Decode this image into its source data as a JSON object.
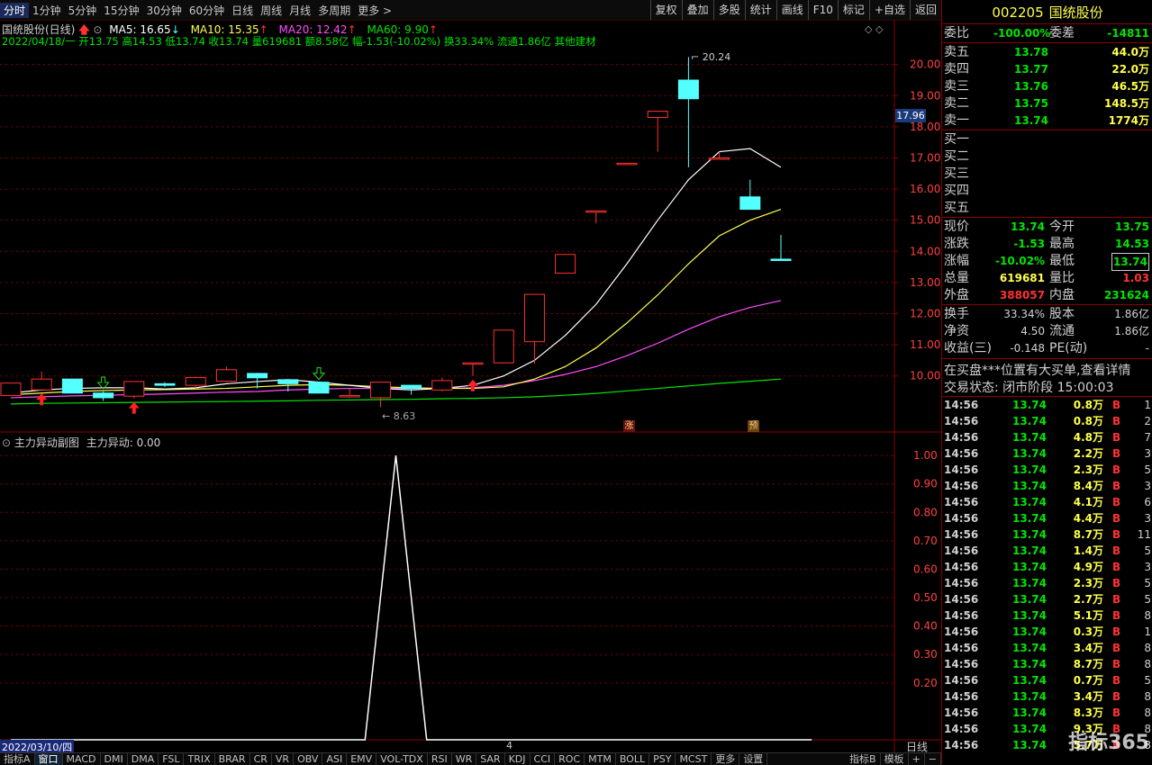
{
  "toolbar": {
    "periods": [
      "分时",
      "1分钟",
      "5分钟",
      "15分钟",
      "30分钟",
      "60分钟",
      "日线",
      "周线",
      "月线",
      "多周期",
      "更多 >"
    ],
    "buttons": [
      "复权",
      "叠加",
      "多股",
      "统计",
      "画线",
      "F10",
      "标记",
      "+自选",
      "返回"
    ]
  },
  "chart_header": {
    "name": "国统股份(日线)",
    "ma5": "MA5: 16.65",
    "ma10": "MA10: 15.35",
    "ma20": "MA20: 12.42",
    "ma60": "MA60: 9.90",
    "ohlc": "2022/04/18/一 开13.75 高14.53 低13.74 收13.74 量619681 额8.58亿 幅-1.53(-10.02%) 换33.34% 流通1.86亿 其他建材",
    "high_label": "20.24",
    "low_label": "8.63",
    "current_price_tag": "17.96",
    "badge_zhang": "涨",
    "badge_yu": "预"
  },
  "sub_header": {
    "title": "主力异动副图",
    "value": "主力异动: 0.00"
  },
  "x_axis": {
    "start": "2022/03/10/四",
    "mark": "4",
    "period": "日线"
  },
  "colors": {
    "up": "#ff3232",
    "down": "#54ffff",
    "ma5": "#ffffff",
    "ma10": "#ffff4c",
    "ma20": "#ff4cff",
    "ma60": "#00e600",
    "grid": "#8a0000"
  },
  "chart_data": [
    {
      "type": "candlestick",
      "y_ticks": [
        10,
        11,
        12,
        13,
        14,
        15,
        16,
        17,
        18,
        19,
        20
      ],
      "ylim": [
        8.2,
        20.8
      ],
      "candles": [
        {
          "o": 9.37,
          "c": 9.77,
          "h": 9.77,
          "l": 9.37
        },
        {
          "o": 9.55,
          "c": 9.9,
          "h": 10.14,
          "l": 9.55
        },
        {
          "o": 9.9,
          "c": 9.45,
          "h": 9.9,
          "l": 9.45
        },
        {
          "o": 9.45,
          "c": 9.3,
          "h": 9.5,
          "l": 9.2
        },
        {
          "o": 9.35,
          "c": 9.82,
          "h": 9.82,
          "l": 9.28
        },
        {
          "o": 9.75,
          "c": 9.7,
          "h": 9.8,
          "l": 9.65
        },
        {
          "o": 9.7,
          "c": 9.95,
          "h": 9.97,
          "l": 9.6
        },
        {
          "o": 9.83,
          "c": 10.2,
          "h": 10.3,
          "l": 9.83
        },
        {
          "o": 10.08,
          "c": 9.94,
          "h": 10.1,
          "l": 9.6
        },
        {
          "o": 9.88,
          "c": 9.75,
          "h": 9.88,
          "l": 9.5
        },
        {
          "o": 9.8,
          "c": 9.45,
          "h": 9.8,
          "l": 9.45
        },
        {
          "o": 9.35,
          "c": 9.37,
          "h": 9.6,
          "l": 9.3
        },
        {
          "o": 9.3,
          "c": 9.8,
          "h": 9.8,
          "l": 9.0
        },
        {
          "o": 9.7,
          "c": 9.6,
          "h": 9.7,
          "l": 9.4
        },
        {
          "o": 9.55,
          "c": 9.85,
          "h": 9.95,
          "l": 9.5
        },
        {
          "o": 10.42,
          "c": 10.42,
          "h": 10.42,
          "l": 10.0
        },
        {
          "o": 10.42,
          "c": 11.47,
          "h": 11.47,
          "l": 10.4
        },
        {
          "o": 11.1,
          "c": 12.62,
          "h": 12.62,
          "l": 10.4
        },
        {
          "o": 13.3,
          "c": 13.9,
          "h": 13.9,
          "l": 13.3
        },
        {
          "o": 15.3,
          "c": 15.3,
          "h": 15.3,
          "l": 14.9
        },
        {
          "o": 16.83,
          "c": 16.83,
          "h": 16.83,
          "l": 16.8
        },
        {
          "o": 18.3,
          "c": 18.5,
          "h": 18.5,
          "l": 17.2
        },
        {
          "o": 19.5,
          "c": 18.9,
          "h": 20.24,
          "l": 16.7
        },
        {
          "o": 17.0,
          "c": 17.0,
          "h": 17.2,
          "l": 17.0
        },
        {
          "o": 15.75,
          "c": 15.35,
          "h": 16.3,
          "l": 15.35
        },
        {
          "o": 13.75,
          "c": 13.74,
          "h": 14.53,
          "l": 13.74
        }
      ],
      "ma5": [
        9.45,
        9.55,
        9.6,
        9.62,
        9.62,
        9.58,
        9.62,
        9.75,
        9.82,
        9.88,
        9.8,
        9.7,
        9.6,
        9.55,
        9.6,
        9.7,
        10.0,
        10.5,
        11.3,
        12.3,
        13.6,
        15.0,
        16.3,
        17.2,
        17.3,
        16.7
      ],
      "ma10": [
        9.4,
        9.45,
        9.5,
        9.53,
        9.55,
        9.56,
        9.58,
        9.6,
        9.65,
        9.7,
        9.72,
        9.7,
        9.65,
        9.62,
        9.6,
        9.6,
        9.65,
        9.9,
        10.3,
        10.9,
        11.7,
        12.6,
        13.6,
        14.5,
        15.0,
        15.35
      ],
      "ma20": [
        9.3,
        9.33,
        9.36,
        9.38,
        9.4,
        9.42,
        9.45,
        9.48,
        9.5,
        9.55,
        9.58,
        9.6,
        9.6,
        9.6,
        9.6,
        9.62,
        9.7,
        9.85,
        10.05,
        10.3,
        10.65,
        11.05,
        11.5,
        11.9,
        12.2,
        12.42
      ],
      "ma60": [
        9.1,
        9.12,
        9.13,
        9.14,
        9.15,
        9.16,
        9.17,
        9.18,
        9.19,
        9.2,
        9.22,
        9.23,
        9.24,
        9.25,
        9.27,
        9.28,
        9.3,
        9.33,
        9.38,
        9.44,
        9.52,
        9.6,
        9.68,
        9.76,
        9.83,
        9.9
      ],
      "arrows": [
        {
          "i": 1,
          "dir": "up",
          "color": "red"
        },
        {
          "i": 3,
          "dir": "down",
          "color": "green"
        },
        {
          "i": 4,
          "dir": "up",
          "color": "red"
        },
        {
          "i": 10,
          "dir": "down",
          "color": "green"
        },
        {
          "i": 15,
          "dir": "up",
          "color": "red"
        }
      ]
    },
    {
      "type": "line",
      "name": "主力异动",
      "y_ticks": [
        0.2,
        0.3,
        0.4,
        0.5,
        0.6,
        0.7,
        0.8,
        0.9,
        1.0
      ],
      "ylim": [
        0,
        1.07
      ],
      "x": [
        0,
        11.5,
        12.5,
        13.5,
        26
      ],
      "values": [
        0,
        0,
        1,
        0,
        0
      ]
    }
  ],
  "panel": {
    "code": "002205",
    "name": "国统股份",
    "weibi_label": "委比",
    "weibi": "-100.00%",
    "weicha_label": "委差",
    "weicha": "-14811",
    "asks": [
      {
        "label": "卖五",
        "price": "13.78",
        "vol": "44.0万"
      },
      {
        "label": "卖四",
        "price": "13.77",
        "vol": "22.0万"
      },
      {
        "label": "卖三",
        "price": "13.76",
        "vol": "46.5万"
      },
      {
        "label": "卖二",
        "price": "13.75",
        "vol": "148.5万"
      },
      {
        "label": "卖一",
        "price": "13.74",
        "vol": "1774万"
      }
    ],
    "bids": [
      "买一",
      "买二",
      "买三",
      "买四",
      "买五"
    ],
    "stats": [
      {
        "l1": "现价",
        "v1": "13.74",
        "c1": "#00e600",
        "l2": "今开",
        "v2": "13.75",
        "c2": "#00e600"
      },
      {
        "l1": "涨跌",
        "v1": "-1.53",
        "c1": "#00e600",
        "l2": "最高",
        "v2": "14.53",
        "c2": "#00e600"
      },
      {
        "l1": "涨幅",
        "v1": "-10.02%",
        "c1": "#00e600",
        "l2": "最低",
        "v2": "13.74",
        "c2": "#00e600"
      },
      {
        "l1": "总量",
        "v1": "619681",
        "c1": "#ffff4c",
        "l2": "量比",
        "v2": "1.03",
        "c2": "#ff3232"
      },
      {
        "l1": "外盘",
        "v1": "388057",
        "c1": "#ff3232",
        "l2": "内盘",
        "v2": "231624",
        "c2": "#00e600"
      }
    ],
    "fund": [
      {
        "l1": "换手",
        "v1": "33.34%",
        "l2": "股本",
        "v2": "1.86亿"
      },
      {
        "l1": "净资",
        "v1": "4.50",
        "l2": "流通",
        "v2": "1.86亿"
      },
      {
        "l1": "收益(三)",
        "v1": "-0.148",
        "l2": "PE(动)",
        "v2": "-"
      }
    ],
    "notice": "在买盘***位置有大买单,查看详情",
    "status": "交易状态: 闭市阶段 15:00:03",
    "ticks": [
      {
        "t": "14:56",
        "p": "13.74",
        "v": "0.8万",
        "n": "1"
      },
      {
        "t": "14:56",
        "p": "13.74",
        "v": "0.8万",
        "n": "2"
      },
      {
        "t": "14:56",
        "p": "13.74",
        "v": "4.8万",
        "n": "7"
      },
      {
        "t": "14:56",
        "p": "13.74",
        "v": "2.2万",
        "n": "3"
      },
      {
        "t": "14:56",
        "p": "13.74",
        "v": "2.3万",
        "n": "5"
      },
      {
        "t": "14:56",
        "p": "13.74",
        "v": "8.4万",
        "n": "3"
      },
      {
        "t": "14:56",
        "p": "13.74",
        "v": "4.1万",
        "n": "6"
      },
      {
        "t": "14:56",
        "p": "13.74",
        "v": "4.4万",
        "n": "3"
      },
      {
        "t": "14:56",
        "p": "13.74",
        "v": "8.7万",
        "n": "11"
      },
      {
        "t": "14:56",
        "p": "13.74",
        "v": "1.4万",
        "n": "5"
      },
      {
        "t": "14:56",
        "p": "13.74",
        "v": "4.9万",
        "n": "3"
      },
      {
        "t": "14:56",
        "p": "13.74",
        "v": "2.3万",
        "n": "5"
      },
      {
        "t": "14:56",
        "p": "13.74",
        "v": "2.7万",
        "n": "5"
      },
      {
        "t": "14:56",
        "p": "13.74",
        "v": "5.1万",
        "n": "8"
      },
      {
        "t": "14:56",
        "p": "13.74",
        "v": "0.3万",
        "n": "1"
      },
      {
        "t": "14:56",
        "p": "13.74",
        "v": "3.4万",
        "n": "8"
      },
      {
        "t": "14:56",
        "p": "13.74",
        "v": "8.7万",
        "n": "8"
      },
      {
        "t": "14:56",
        "p": "13.74",
        "v": "0.7万",
        "n": "5"
      },
      {
        "t": "14:56",
        "p": "13.74",
        "v": "3.4万",
        "n": "8"
      },
      {
        "t": "14:56",
        "p": "13.74",
        "v": "8.3万",
        "n": "8"
      },
      {
        "t": "14:56",
        "p": "13.74",
        "v": "9.3万",
        "n": "8"
      },
      {
        "t": "14:56",
        "p": "13.74",
        "v": "5.7万",
        "n": "8"
      }
    ],
    "tick_side": "B",
    "watermark": "指标365"
  },
  "tabs": [
    "指标A",
    "窗口",
    "MACD",
    "DMI",
    "DMA",
    "FSL",
    "TRIX",
    "BRAR",
    "CR",
    "VR",
    "OBV",
    "ASI",
    "EMV",
    "VOL-TDX",
    "RSI",
    "WR",
    "SAR",
    "KDJ",
    "CCI",
    "ROC",
    "MTM",
    "BOLL",
    "PSY",
    "MCST",
    "更多",
    "设置"
  ],
  "tabs_right": [
    "指标B",
    "模板",
    "+",
    "−"
  ]
}
